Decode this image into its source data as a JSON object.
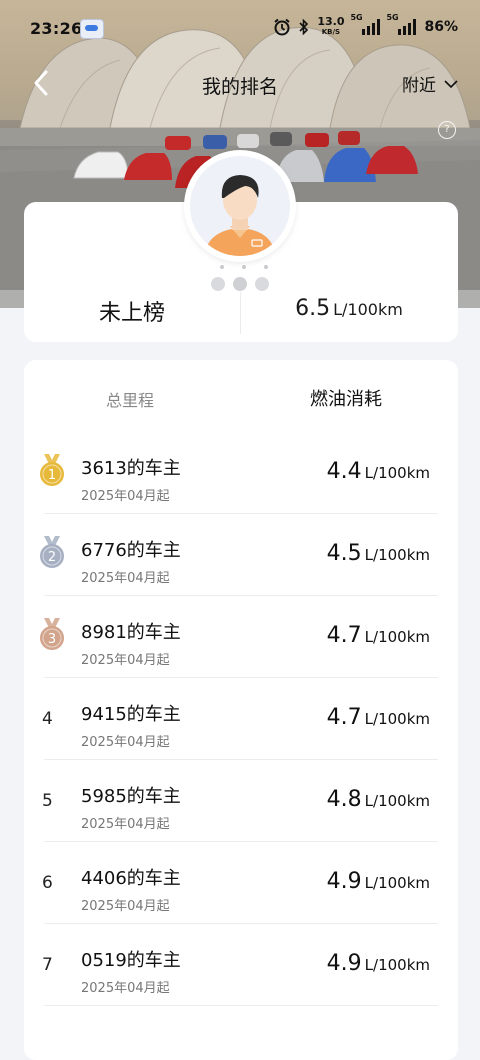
{
  "status_bar": {
    "time": "23:26",
    "speed_value": "13.0",
    "speed_unit": "KB/S",
    "network1": "5G",
    "network2": "5G",
    "battery": "86%"
  },
  "nav": {
    "title": "我的排名",
    "location_filter": "附近"
  },
  "my_rank": {
    "rank_text": "未上榜",
    "fuel_value": "6.5",
    "fuel_unit": "L/100km"
  },
  "list_header": {
    "mileage_tab": "总里程",
    "fuel_tab": "燃油消耗"
  },
  "colors": {
    "gold": "#e7b93a",
    "silver": "#a6b0c2",
    "bronze": "#d2a48c"
  },
  "rankings": [
    {
      "rank": "1",
      "owner": "3613的车主",
      "since": "2025年04月起",
      "fuel": "4.4",
      "unit": "L/100km",
      "medal": "gold"
    },
    {
      "rank": "2",
      "owner": "6776的车主",
      "since": "2025年04月起",
      "fuel": "4.5",
      "unit": "L/100km",
      "medal": "silver"
    },
    {
      "rank": "3",
      "owner": "8981的车主",
      "since": "2025年04月起",
      "fuel": "4.7",
      "unit": "L/100km",
      "medal": "bronze"
    },
    {
      "rank": "4",
      "owner": "9415的车主",
      "since": "2025年04月起",
      "fuel": "4.7",
      "unit": "L/100km",
      "medal": ""
    },
    {
      "rank": "5",
      "owner": "5985的车主",
      "since": "2025年04月起",
      "fuel": "4.8",
      "unit": "L/100km",
      "medal": ""
    },
    {
      "rank": "6",
      "owner": "4406的车主",
      "since": "2025年04月起",
      "fuel": "4.9",
      "unit": "L/100km",
      "medal": ""
    },
    {
      "rank": "7",
      "owner": "0519的车主",
      "since": "2025年04月起",
      "fuel": "4.9",
      "unit": "L/100km",
      "medal": ""
    }
  ]
}
